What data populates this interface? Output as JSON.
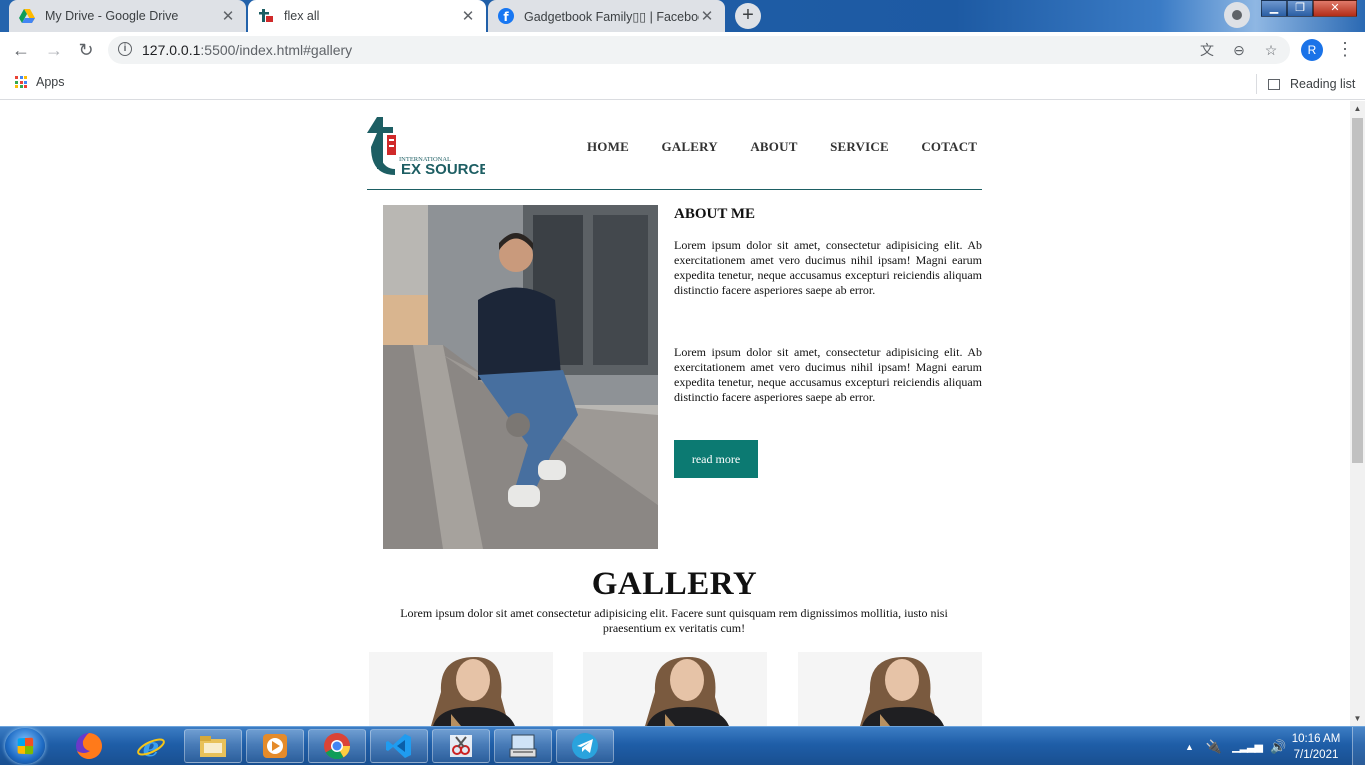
{
  "browser": {
    "tabs": [
      {
        "title": "My Drive - Google Drive",
        "favicon": "google-drive-icon",
        "active": false
      },
      {
        "title": "flex all",
        "favicon": "ts-logo-icon",
        "active": true
      },
      {
        "title": "Gadgetbook Family▯▯ | Faceboo",
        "favicon": "facebook-icon",
        "active": false
      }
    ],
    "url_host": "127.0.0.1",
    "url_path": ":5500/index.html#gallery",
    "profile_initial": "R",
    "bookmarks": {
      "apps_label": "Apps",
      "reading_list_label": "Reading list"
    }
  },
  "site": {
    "logo": {
      "top_text": "INTERNATIONAL",
      "brand": "EX SOURCE",
      "brand_initial": "T"
    },
    "nav": [
      "HOME",
      "GALERY",
      "ABOUT",
      "SERVICE",
      "COTACT"
    ],
    "about": {
      "heading": "ABOUT ME",
      "paragraphs": [
        "Lorem ipsum dolor sit amet, consectetur adipisicing elit. Ab exercitationem amet vero ducimus nihil ipsam! Magni earum expedita tenetur, neque accusamus excepturi reiciendis aliquam distinctio facere asperiores saepe ab error.",
        "Lorem ipsum dolor sit amet, consectetur adipisicing elit. Ab exercitationem amet vero ducimus nihil ipsam! Magni earum expedita tenetur, neque accusamus excepturi reiciendis aliquam distinctio facere asperiores saepe ab error."
      ],
      "button": "read more"
    },
    "gallery": {
      "title": "GALLERY",
      "description": "Lorem ipsum dolor sit amet consectetur adipisicing elit. Facere sunt quisquam rem dignissimos mollitia, iusto nisi praesentium ex veritatis cum!"
    }
  },
  "taskbar": {
    "time": "10:16 AM",
    "date": "7/1/2021"
  },
  "colors": {
    "accent": "#0c7a72",
    "header_rule": "#1d5e63",
    "logo_teal": "#1d5e63",
    "logo_red": "#d02a2a"
  }
}
